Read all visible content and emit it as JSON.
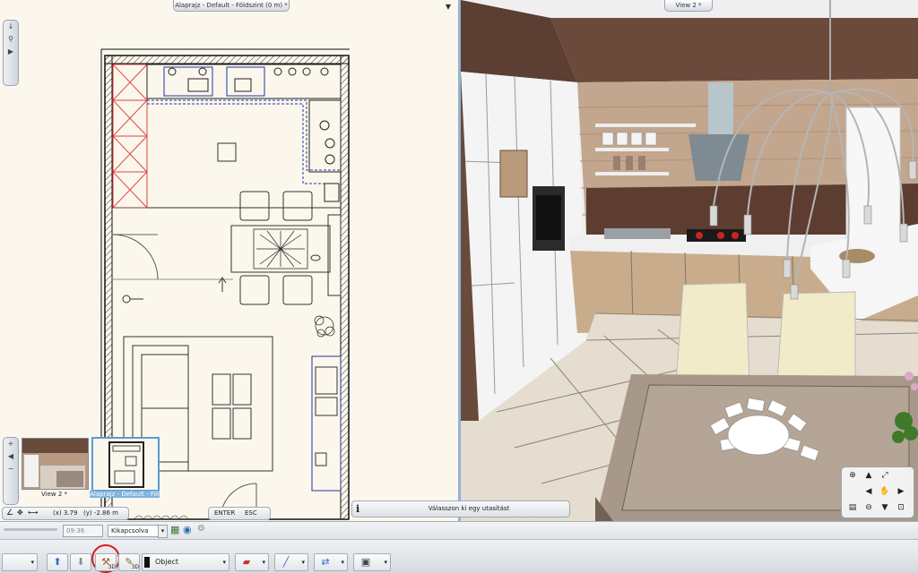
{
  "plan_window": {
    "title": "Alaprajz - Default - Földszint (0 m) *",
    "menu_icon": "triangle-down-icon"
  },
  "view3d_window": {
    "title": "View 2 *"
  },
  "thumbnails": [
    {
      "label": "View 2 *"
    },
    {
      "label": "Alaprajz - Default - Föl"
    }
  ],
  "status": {
    "coord_x": "(x) 3.79",
    "coord_y": "(y) -2.86 m",
    "enter_label": "ENTER",
    "esc_label": "ESC",
    "prompt": "Válasszon ki egy utasítást",
    "info_icon": "info-icon"
  },
  "toolbar1": {
    "time": "09:36",
    "snap_value": "Kikapcsolva"
  },
  "toolbar2": {
    "object_value": "Object",
    "badge_3d": "3D"
  },
  "colors": {
    "accent": "#8fb4d4",
    "highlight_ring": "#d21e1e",
    "wall": "#1a1a1a",
    "plan_bg": "#fbf7ec"
  }
}
